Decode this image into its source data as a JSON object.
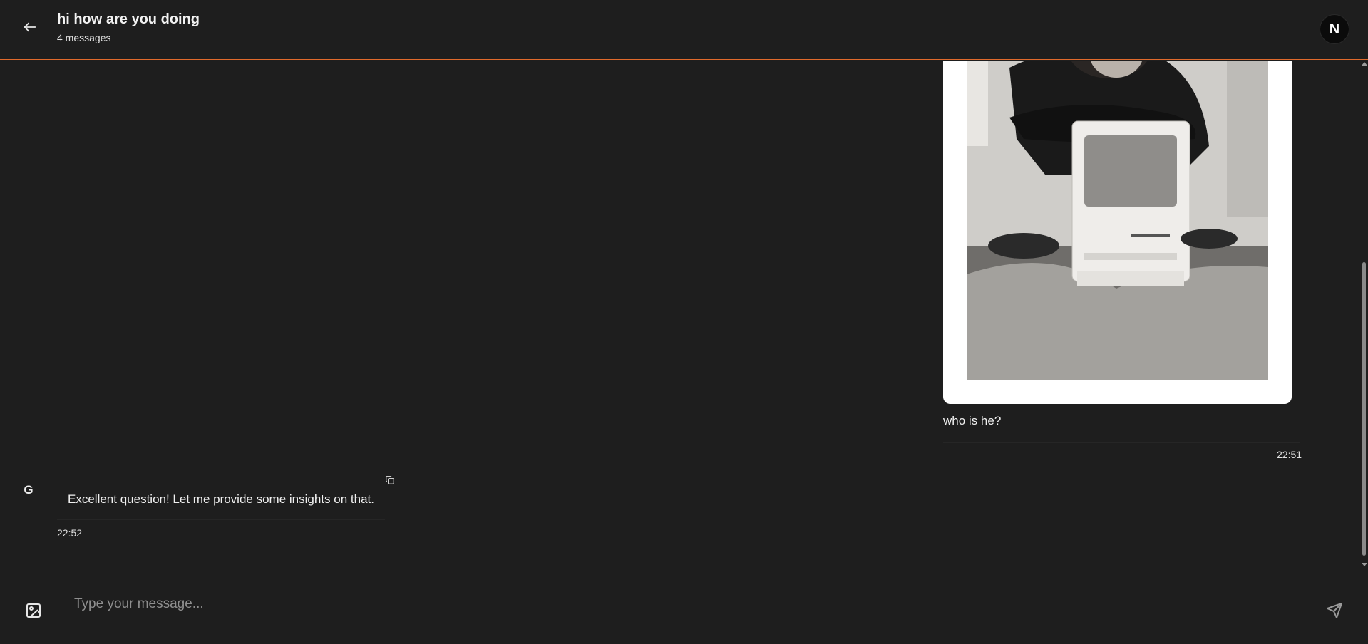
{
  "header": {
    "title": "hi how are you doing",
    "subtitle": "4 messages",
    "back_icon": "arrow-left-icon",
    "avatar_letter": "N"
  },
  "messages": {
    "user": {
      "image_description_icon": "photo",
      "text": "who is he?",
      "time": "22:51"
    },
    "assistant": {
      "avatar_letter": "G",
      "text": "Excellent question! Let me provide some insights on that.",
      "time": "22:52",
      "copy_icon": "copy-icon"
    }
  },
  "composer": {
    "placeholder": "Type your message...",
    "image_icon": "image-icon",
    "send_icon": "send-icon"
  },
  "colors": {
    "background": "#1e1e1e",
    "accent_border": "#e06a2c",
    "text": "#f0f0f0",
    "muted": "#8f8f8f"
  }
}
